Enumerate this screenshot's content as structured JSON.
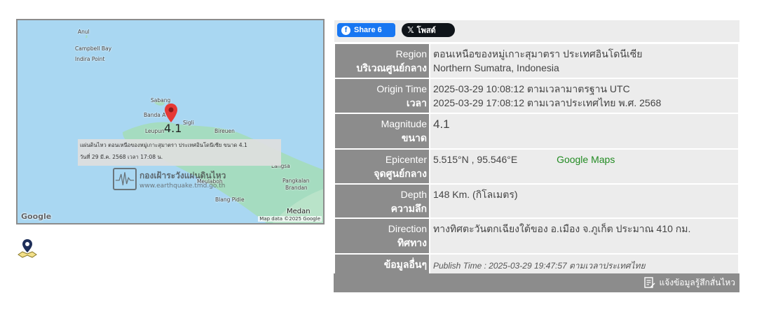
{
  "map": {
    "places": {
      "anul": "Anul",
      "campbell_bay": "Campbell Bay",
      "indira_point": "Indira Point",
      "sabang": "Sabang",
      "banda_aceh": "Banda A",
      "sigli": "Sigli",
      "leupung": "Leupun",
      "bireuen": "Bireuen",
      "langsa": "Langsa",
      "meulaboh": "Meulaboh",
      "pangkalan": "Pangkalan",
      "brandan": "Brandan",
      "blang_pidie": "Blang Pidie",
      "medan": "Medan"
    },
    "marker_magnitude": "4.1",
    "popup_line1": "แผ่นดินไหว ตอนเหนือของหมู่เกาะสุมาตรา ประเทศอินโดนีเซีย ขนาด 4.1",
    "popup_line2": "วันที่ 29 มี.ค. 2568 เวลา 17:08 น.",
    "watermark_title": "กองเฝ้าระวังแผ่นดินไหว",
    "watermark_url": "www.earthquake.tmd.go.th",
    "google_logo": "Google",
    "map_data": "Map data ©2025 Google"
  },
  "share": {
    "facebook_label": "Share 6",
    "x_label": "โพสต์"
  },
  "details": {
    "region": {
      "label_en": "Region",
      "label_th": "บริเวณศูนย์กลาง",
      "value_th": "ตอนเหนือของหมู่เกาะสุมาตรา ประเทศอินโดนีเซีย",
      "value_en": "Northern Sumatra, Indonesia"
    },
    "origin_time": {
      "label_en": "Origin Time",
      "label_th": "เวลา",
      "utc": "2025-03-29 10:08:12 ตามเวลามาตรฐาน UTC",
      "local": "2025-03-29 17:08:12 ตามเวลาประเทศไทย พ.ศ. 2568"
    },
    "magnitude": {
      "label_en": "Magnitude",
      "label_th": "ขนาด",
      "value": "4.1"
    },
    "epicenter": {
      "label_en": "Epicenter",
      "label_th": "จุดศูนย์กลาง",
      "value": "5.515°N , 95.546°E",
      "maps_link": "Google Maps"
    },
    "depth": {
      "label_en": "Depth",
      "label_th": "ความลึก",
      "value": "148 Km. (กิโลเมตร)"
    },
    "direction": {
      "label_en": "Direction",
      "label_th": "ทิศทาง",
      "value": "ทางทิศตะวันตกเฉียงใต้ของ อ.เมือง จ.ภูเก็ต ประมาณ 410 กม."
    },
    "other": {
      "label_th": "ข้อมูลอื่นๆ",
      "publish": "Publish Time : 2025-03-29 19:47:57 ตามเวลาประเทศไทย"
    }
  },
  "footer": {
    "report_label": "แจ้งข้อมูลรู้สึกสั่นไหว"
  },
  "colors": {
    "label_bg": "#8c8c8c",
    "value_bg": "#ececec",
    "facebook": "#1877f2",
    "x": "#0f1419",
    "link_green": "#228b22",
    "pin_red": "#e53935",
    "sea": "#a9d7f2",
    "land": "#a5dcc0"
  }
}
